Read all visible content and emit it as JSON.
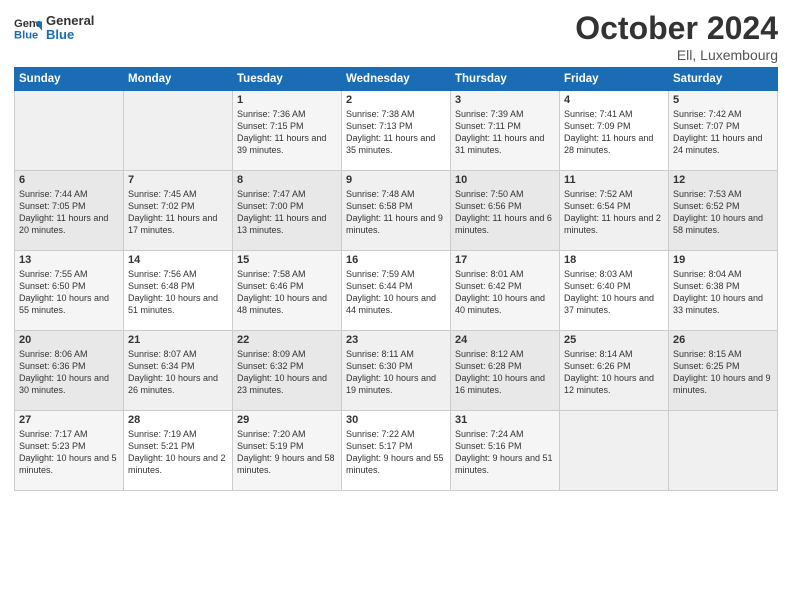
{
  "header": {
    "logo_line1": "General",
    "logo_line2": "Blue",
    "month": "October 2024",
    "location": "Ell, Luxembourg"
  },
  "weekdays": [
    "Sunday",
    "Monday",
    "Tuesday",
    "Wednesday",
    "Thursday",
    "Friday",
    "Saturday"
  ],
  "weeks": [
    [
      {
        "day": "",
        "sunrise": "",
        "sunset": "",
        "daylight": ""
      },
      {
        "day": "",
        "sunrise": "",
        "sunset": "",
        "daylight": ""
      },
      {
        "day": "1",
        "sunrise": "Sunrise: 7:36 AM",
        "sunset": "Sunset: 7:15 PM",
        "daylight": "Daylight: 11 hours and 39 minutes."
      },
      {
        "day": "2",
        "sunrise": "Sunrise: 7:38 AM",
        "sunset": "Sunset: 7:13 PM",
        "daylight": "Daylight: 11 hours and 35 minutes."
      },
      {
        "day": "3",
        "sunrise": "Sunrise: 7:39 AM",
        "sunset": "Sunset: 7:11 PM",
        "daylight": "Daylight: 11 hours and 31 minutes."
      },
      {
        "day": "4",
        "sunrise": "Sunrise: 7:41 AM",
        "sunset": "Sunset: 7:09 PM",
        "daylight": "Daylight: 11 hours and 28 minutes."
      },
      {
        "day": "5",
        "sunrise": "Sunrise: 7:42 AM",
        "sunset": "Sunset: 7:07 PM",
        "daylight": "Daylight: 11 hours and 24 minutes."
      }
    ],
    [
      {
        "day": "6",
        "sunrise": "Sunrise: 7:44 AM",
        "sunset": "Sunset: 7:05 PM",
        "daylight": "Daylight: 11 hours and 20 minutes."
      },
      {
        "day": "7",
        "sunrise": "Sunrise: 7:45 AM",
        "sunset": "Sunset: 7:02 PM",
        "daylight": "Daylight: 11 hours and 17 minutes."
      },
      {
        "day": "8",
        "sunrise": "Sunrise: 7:47 AM",
        "sunset": "Sunset: 7:00 PM",
        "daylight": "Daylight: 11 hours and 13 minutes."
      },
      {
        "day": "9",
        "sunrise": "Sunrise: 7:48 AM",
        "sunset": "Sunset: 6:58 PM",
        "daylight": "Daylight: 11 hours and 9 minutes."
      },
      {
        "day": "10",
        "sunrise": "Sunrise: 7:50 AM",
        "sunset": "Sunset: 6:56 PM",
        "daylight": "Daylight: 11 hours and 6 minutes."
      },
      {
        "day": "11",
        "sunrise": "Sunrise: 7:52 AM",
        "sunset": "Sunset: 6:54 PM",
        "daylight": "Daylight: 11 hours and 2 minutes."
      },
      {
        "day": "12",
        "sunrise": "Sunrise: 7:53 AM",
        "sunset": "Sunset: 6:52 PM",
        "daylight": "Daylight: 10 hours and 58 minutes."
      }
    ],
    [
      {
        "day": "13",
        "sunrise": "Sunrise: 7:55 AM",
        "sunset": "Sunset: 6:50 PM",
        "daylight": "Daylight: 10 hours and 55 minutes."
      },
      {
        "day": "14",
        "sunrise": "Sunrise: 7:56 AM",
        "sunset": "Sunset: 6:48 PM",
        "daylight": "Daylight: 10 hours and 51 minutes."
      },
      {
        "day": "15",
        "sunrise": "Sunrise: 7:58 AM",
        "sunset": "Sunset: 6:46 PM",
        "daylight": "Daylight: 10 hours and 48 minutes."
      },
      {
        "day": "16",
        "sunrise": "Sunrise: 7:59 AM",
        "sunset": "Sunset: 6:44 PM",
        "daylight": "Daylight: 10 hours and 44 minutes."
      },
      {
        "day": "17",
        "sunrise": "Sunrise: 8:01 AM",
        "sunset": "Sunset: 6:42 PM",
        "daylight": "Daylight: 10 hours and 40 minutes."
      },
      {
        "day": "18",
        "sunrise": "Sunrise: 8:03 AM",
        "sunset": "Sunset: 6:40 PM",
        "daylight": "Daylight: 10 hours and 37 minutes."
      },
      {
        "day": "19",
        "sunrise": "Sunrise: 8:04 AM",
        "sunset": "Sunset: 6:38 PM",
        "daylight": "Daylight: 10 hours and 33 minutes."
      }
    ],
    [
      {
        "day": "20",
        "sunrise": "Sunrise: 8:06 AM",
        "sunset": "Sunset: 6:36 PM",
        "daylight": "Daylight: 10 hours and 30 minutes."
      },
      {
        "day": "21",
        "sunrise": "Sunrise: 8:07 AM",
        "sunset": "Sunset: 6:34 PM",
        "daylight": "Daylight: 10 hours and 26 minutes."
      },
      {
        "day": "22",
        "sunrise": "Sunrise: 8:09 AM",
        "sunset": "Sunset: 6:32 PM",
        "daylight": "Daylight: 10 hours and 23 minutes."
      },
      {
        "day": "23",
        "sunrise": "Sunrise: 8:11 AM",
        "sunset": "Sunset: 6:30 PM",
        "daylight": "Daylight: 10 hours and 19 minutes."
      },
      {
        "day": "24",
        "sunrise": "Sunrise: 8:12 AM",
        "sunset": "Sunset: 6:28 PM",
        "daylight": "Daylight: 10 hours and 16 minutes."
      },
      {
        "day": "25",
        "sunrise": "Sunrise: 8:14 AM",
        "sunset": "Sunset: 6:26 PM",
        "daylight": "Daylight: 10 hours and 12 minutes."
      },
      {
        "day": "26",
        "sunrise": "Sunrise: 8:15 AM",
        "sunset": "Sunset: 6:25 PM",
        "daylight": "Daylight: 10 hours and 9 minutes."
      }
    ],
    [
      {
        "day": "27",
        "sunrise": "Sunrise: 7:17 AM",
        "sunset": "Sunset: 5:23 PM",
        "daylight": "Daylight: 10 hours and 5 minutes."
      },
      {
        "day": "28",
        "sunrise": "Sunrise: 7:19 AM",
        "sunset": "Sunset: 5:21 PM",
        "daylight": "Daylight: 10 hours and 2 minutes."
      },
      {
        "day": "29",
        "sunrise": "Sunrise: 7:20 AM",
        "sunset": "Sunset: 5:19 PM",
        "daylight": "Daylight: 9 hours and 58 minutes."
      },
      {
        "day": "30",
        "sunrise": "Sunrise: 7:22 AM",
        "sunset": "Sunset: 5:17 PM",
        "daylight": "Daylight: 9 hours and 55 minutes."
      },
      {
        "day": "31",
        "sunrise": "Sunrise: 7:24 AM",
        "sunset": "Sunset: 5:16 PM",
        "daylight": "Daylight: 9 hours and 51 minutes."
      },
      {
        "day": "",
        "sunrise": "",
        "sunset": "",
        "daylight": ""
      },
      {
        "day": "",
        "sunrise": "",
        "sunset": "",
        "daylight": ""
      }
    ]
  ]
}
